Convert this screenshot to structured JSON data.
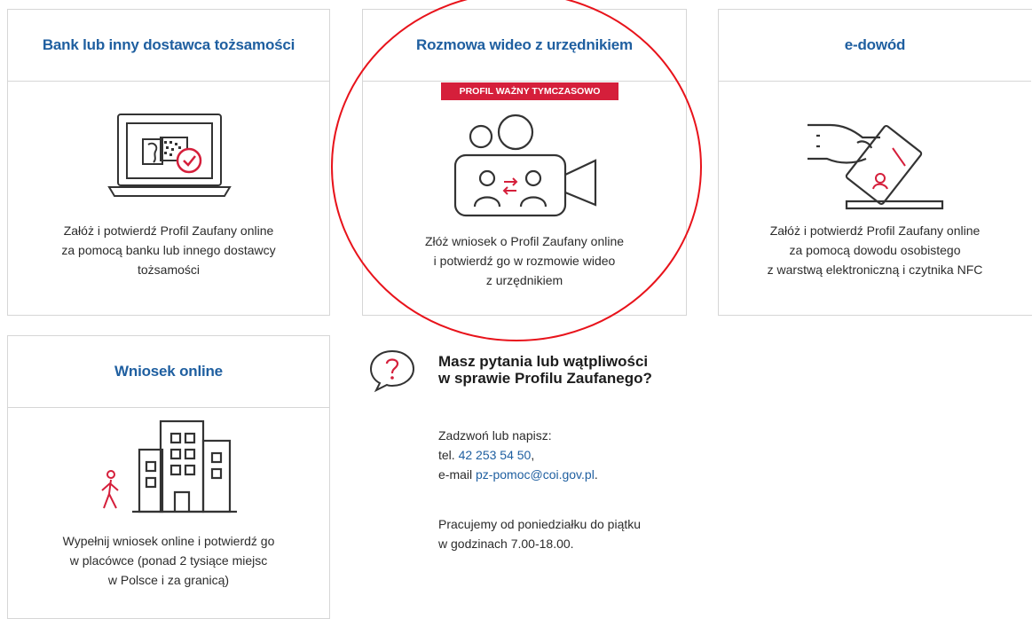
{
  "cards": [
    {
      "title": "Bank lub inny dostawca tożsamości",
      "desc": [
        "Załóż i potwierdź Profil Zaufany online",
        "za pomocą banku lub innego dostawcy",
        "tożsamości"
      ]
    },
    {
      "title": "Rozmowa wideo z urzędnikiem",
      "badge": "PROFIL WAŻNY TYMCZASOWO",
      "desc": [
        "Złóż wniosek o Profil Zaufany online",
        "i potwierdź go w rozmowie wideo",
        "z urzędnikiem"
      ]
    },
    {
      "title": "e-dowód",
      "desc": [
        "Załóż i potwierdź Profil Zaufany online",
        "za pomocą dowodu osobistego",
        "z warstwą elektroniczną i czytnika NFC"
      ]
    },
    {
      "title": "Wniosek online",
      "desc": [
        "Wypełnij wniosek online i potwierdź go",
        "w placówce (ponad 2 tysiące miejsc",
        "w Polsce i za granicą)"
      ]
    }
  ],
  "help": {
    "title_line1": "Masz pytania lub wątpliwości",
    "title_line2": "w sprawie Profilu Zaufanego?",
    "contact_intro": "Zadzwoń lub napisz:",
    "tel_label": "tel. ",
    "tel_value": "42 253 54 50",
    "tel_suffix": ",",
    "email_label": "e-mail ",
    "email_value": "pz-pomoc@coi.gov.pl",
    "email_suffix": ".",
    "hours_line1": "Pracujemy od poniedziałku do piątku",
    "hours_line2": "w godzinach 7.00-18.00."
  },
  "icons": {
    "card1": "laptop-id-check-icon",
    "card2": "video-call-icon",
    "card3": "hand-id-card-icon",
    "card4": "building-walker-icon",
    "help": "question-bubble-icon"
  },
  "colors": {
    "title_blue": "#1f5fa0",
    "badge_red": "#d51f3b",
    "annotation_red": "#e8131b"
  }
}
